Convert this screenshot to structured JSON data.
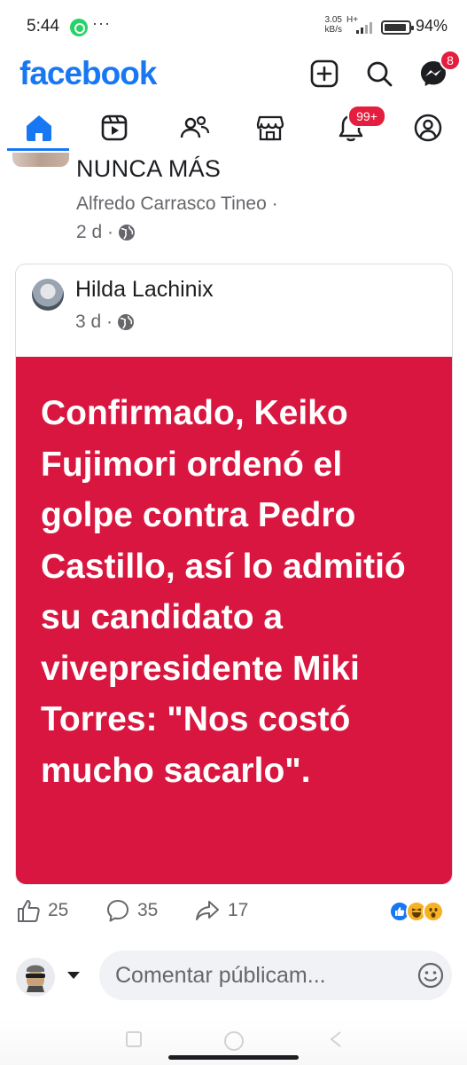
{
  "status_bar": {
    "time": "5:44",
    "more": "···",
    "speed_top": "3.05",
    "speed_bottom": "kB/s",
    "network": "H+",
    "battery_pct": "94%"
  },
  "header": {
    "logo": "facebook",
    "messenger_badge": "8",
    "brand_color": "#1877f2"
  },
  "nav": {
    "notifications_badge": "99+",
    "tabs": [
      "home-icon",
      "video-icon",
      "friends-icon",
      "marketplace-icon",
      "bell-icon",
      "profile-icon"
    ]
  },
  "previous_post": {
    "title": "NUNCA MÁS",
    "author": "Alfredo Carrasco Tineo ·",
    "time": "2 d ·"
  },
  "shared_post": {
    "author": "Hilda Lachinix",
    "time": "3 d ·",
    "text": "Confirmado, Keiko Fujimori ordenó el golpe contra Pedro Castillo, así lo admitió su candidato a vivepresidente Miki Torres: \"Nos costó mucho sacarlo\".",
    "background_color": "#d8163f"
  },
  "reactions": {
    "likes": "25",
    "comments": "35",
    "shares": "17"
  },
  "comment": {
    "placeholder": "Comentar públicam..."
  }
}
